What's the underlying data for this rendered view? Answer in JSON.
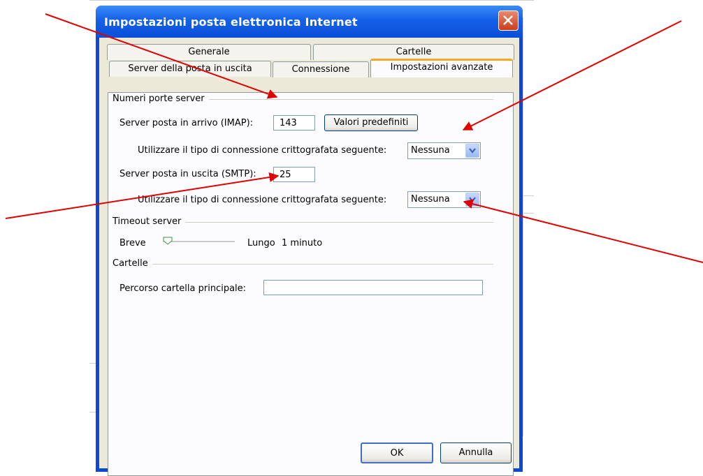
{
  "dialog": {
    "title": "Impostazioni posta elettronica Internet",
    "close_icon": "close-icon"
  },
  "tabs": {
    "row_back": [
      {
        "label": "Generale"
      },
      {
        "label": "Cartelle"
      }
    ],
    "row_front": [
      {
        "label": "Server della posta in uscita"
      },
      {
        "label": "Connessione"
      },
      {
        "label": "Impostazioni avanzate",
        "active": true
      }
    ]
  },
  "ports": {
    "group_label": "Numeri porte server",
    "imap_label": "Server posta in arrivo (IMAP):",
    "imap_value": "143",
    "defaults_button": "Valori predefiniti",
    "encryption_label_1": "Utilizzare il tipo di connessione crittografata seguente:",
    "encryption_value_1": "Nessuna",
    "smtp_label": "Server posta in uscita (SMTP):",
    "smtp_value": "25",
    "encryption_label_2": "Utilizzare il tipo di connessione crittografata seguente:",
    "encryption_value_2": "Nessuna"
  },
  "timeout": {
    "group_label": "Timeout server",
    "short_label": "Breve",
    "long_label": "Lungo",
    "value_text": "1 minuto",
    "slider_level": 0
  },
  "folders": {
    "group_label": "Cartelle",
    "root_path_label": "Percorso cartella principale:",
    "root_path_value": ""
  },
  "footer": {
    "ok": "OK",
    "cancel": "Annulla"
  },
  "colors": {
    "annotation_arrow": "#e00000",
    "titlebar": "#0a4fd8",
    "active_tab_accent": "#f5a623"
  }
}
